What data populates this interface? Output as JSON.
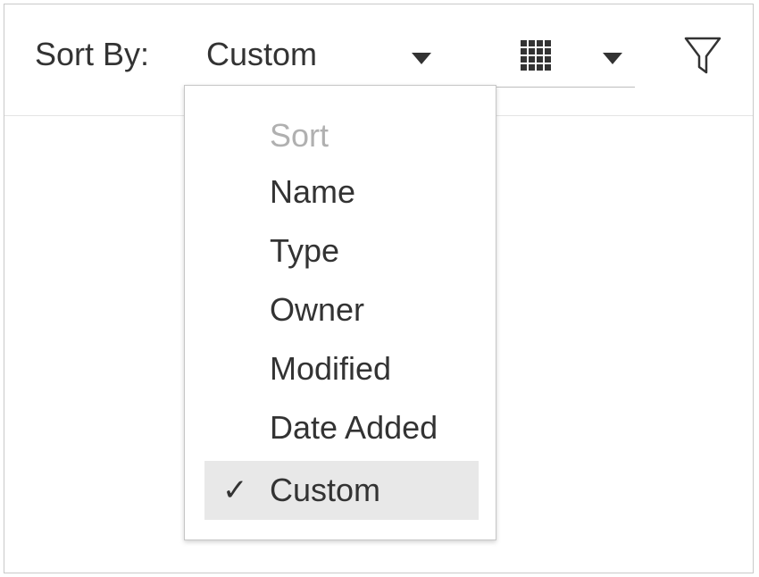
{
  "toolbar": {
    "sort_label": "Sort By:",
    "sort_value": "Custom",
    "sort_caret_icon": "caret-down-icon",
    "view_icon": "grid-view-icon",
    "view_caret_icon": "caret-down-icon",
    "filter_icon": "filter-icon"
  },
  "sort_menu": {
    "header": "Sort",
    "items": [
      {
        "label": "Name",
        "selected": false
      },
      {
        "label": "Type",
        "selected": false
      },
      {
        "label": "Owner",
        "selected": false
      },
      {
        "label": "Modified",
        "selected": false
      },
      {
        "label": "Date Added",
        "selected": false
      },
      {
        "label": "Custom",
        "selected": true
      }
    ],
    "check_mark": "✓"
  },
  "colors": {
    "text": "#333333",
    "header_text": "#b0b0b0",
    "selected_bg": "#e8e8e8",
    "border": "#c9c9c9"
  }
}
